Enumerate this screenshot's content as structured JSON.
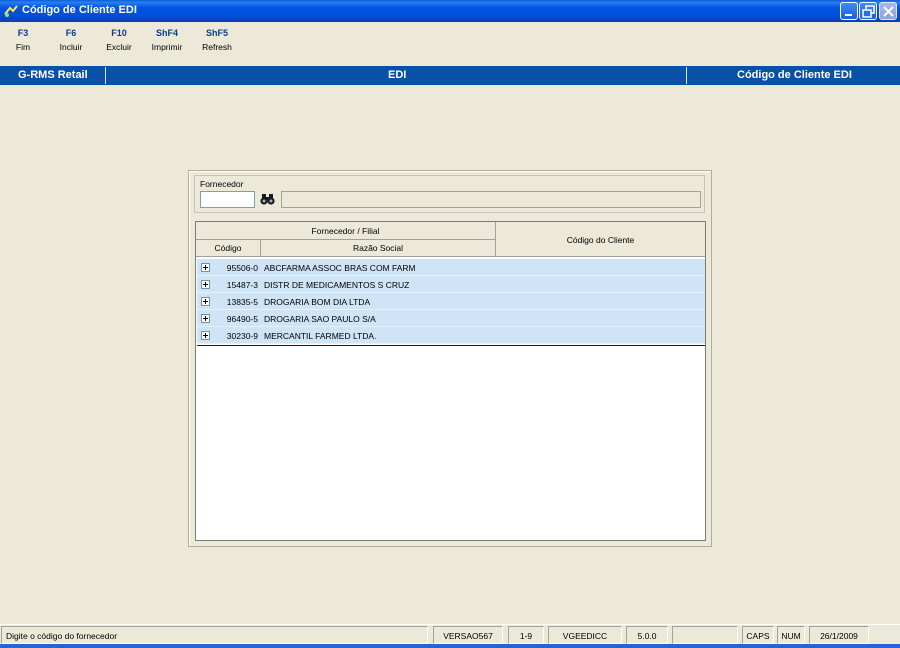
{
  "window": {
    "title": "Código de Cliente EDI"
  },
  "toolbar": {
    "keys": [
      {
        "key": "F3",
        "label": "Fim"
      },
      {
        "key": "F6",
        "label": "Incluir"
      },
      {
        "key": "F10",
        "label": "Excluir"
      },
      {
        "key": "ShF4",
        "label": "Imprimir"
      },
      {
        "key": "ShF5",
        "label": "Refresh"
      }
    ]
  },
  "header": {
    "left": "G-RMS Retail",
    "center": "EDI",
    "right": "Código de Cliente EDI"
  },
  "filter": {
    "label": "Fornecedor",
    "code_value": "",
    "description_value": ""
  },
  "grid": {
    "group_header": "Fornecedor / Filial",
    "col_code": "Código",
    "col_name": "Razão Social",
    "col_client": "Código do Cliente",
    "rows": [
      {
        "code": "95506-0",
        "name": "ABCFARMA ASSOC BRAS COM FARM",
        "client": ""
      },
      {
        "code": "15487-3",
        "name": "DISTR DE MEDICAMENTOS S CRUZ",
        "client": ""
      },
      {
        "code": "13835-5",
        "name": "DROGARIA BOM DIA LTDA",
        "client": ""
      },
      {
        "code": "96490-5",
        "name": "DROGARIA SAO PAULO S/A",
        "client": ""
      },
      {
        "code": "30230-9",
        "name": "MERCANTIL FARMED LTDA.",
        "client": ""
      }
    ]
  },
  "status": {
    "message": "Digite o código do fornecedor",
    "version": "VERSAO567",
    "page": "1-9",
    "program": "VGEEDICC",
    "release": "5.0.0",
    "blank": "",
    "caps": "CAPS",
    "num": "NUM",
    "date": "26/1/2009"
  },
  "colors": {
    "title_bar": "#0054e3",
    "header_bar": "#0950a8",
    "row_highlight": "#cfe4f7",
    "fkey_text": "#0b3c8c"
  }
}
